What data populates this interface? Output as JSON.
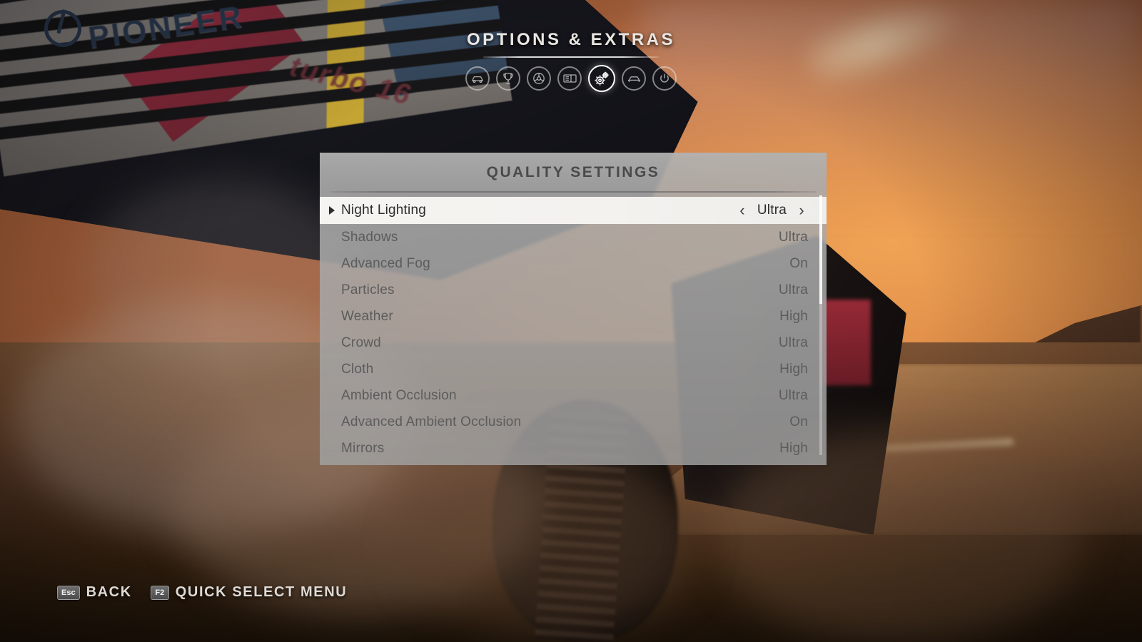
{
  "header": {
    "title": "OPTIONS & EXTRAS",
    "tabs": [
      {
        "icon": "car-icon",
        "label": "Vehicle",
        "active": false
      },
      {
        "icon": "trophy-icon",
        "label": "Career",
        "active": false
      },
      {
        "icon": "steering-wheel-icon",
        "label": "Controls",
        "active": false
      },
      {
        "icon": "display-icon",
        "label": "Display",
        "active": false
      },
      {
        "icon": "gears-icon",
        "label": "Settings",
        "active": true
      },
      {
        "icon": "car-rear-icon",
        "label": "Garage",
        "active": false
      },
      {
        "icon": "power-icon",
        "label": "Quit",
        "active": false
      }
    ]
  },
  "panel": {
    "title": "QUALITY SETTINGS",
    "caret_left": "‹",
    "caret_right": "›",
    "rows": [
      {
        "label": "Night Lighting",
        "value": "Ultra",
        "selected": true
      },
      {
        "label": "Shadows",
        "value": "Ultra",
        "selected": false
      },
      {
        "label": "Advanced Fog",
        "value": "On",
        "selected": false
      },
      {
        "label": "Particles",
        "value": "Ultra",
        "selected": false
      },
      {
        "label": "Weather",
        "value": "High",
        "selected": false
      },
      {
        "label": "Crowd",
        "value": "Ultra",
        "selected": false
      },
      {
        "label": "Cloth",
        "value": "High",
        "selected": false
      },
      {
        "label": "Ambient Occlusion",
        "value": "Ultra",
        "selected": false
      },
      {
        "label": "Advanced Ambient Occlusion",
        "value": "On",
        "selected": false
      },
      {
        "label": "Mirrors",
        "value": "High",
        "selected": false
      }
    ]
  },
  "footer": {
    "hints": [
      {
        "key": "Esc",
        "label": "BACK"
      },
      {
        "key": "F2",
        "label": "QUICK SELECT MENU"
      }
    ]
  },
  "background": {
    "sponsor_text": "PIONEER",
    "livery_text": "turbo 16"
  },
  "colors": {
    "panel_bg": "#aaaaaa",
    "selected_row_bg": "#f5f3f0",
    "row_text": "#5c5c5c",
    "selected_text": "#2b2b2b",
    "accent_white": "#ffffff",
    "sky_orange": "#e8a45c"
  }
}
